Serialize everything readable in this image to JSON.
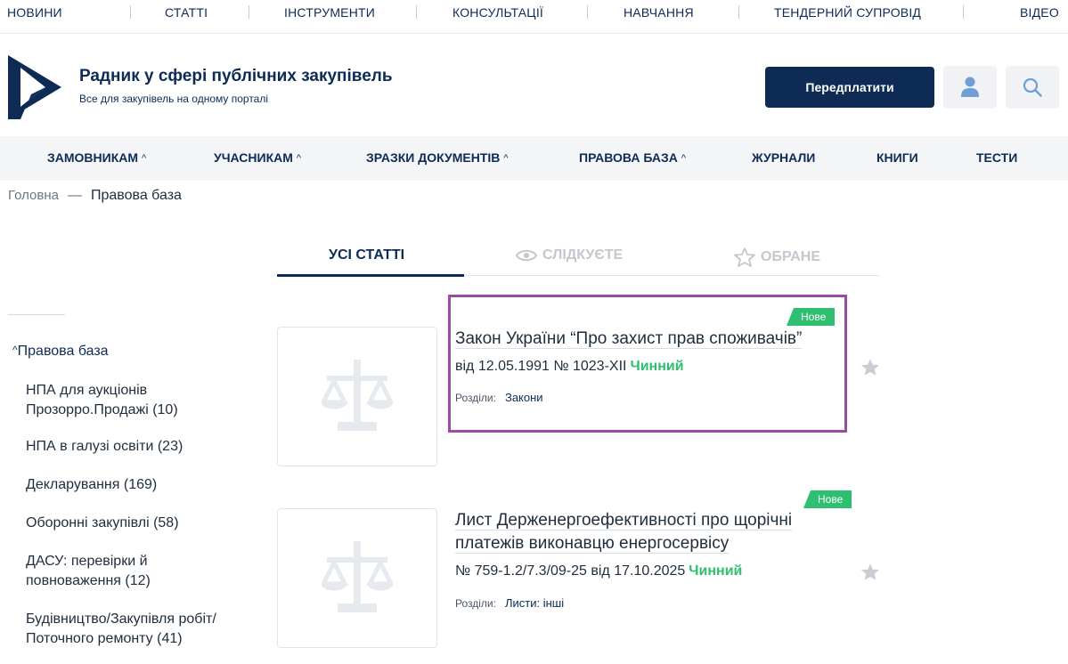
{
  "top_nav": [
    "НОВИНИ",
    "СТАТТІ",
    "ІНСТРУМЕНТИ",
    "КОНСУЛЬТАЦІЇ",
    "НАВЧАННЯ",
    "ТЕНДЕРНИЙ СУПРОВІД",
    "ВІДЕО"
  ],
  "header": {
    "title": "Радник у сфері публічних закупівель",
    "subtitle": "Все для закупівель на одному порталі",
    "subscribe_label": "Передплатити",
    "user_icon": "user-icon",
    "search_icon": "search-icon",
    "brand_color": "#0d2b55"
  },
  "main_nav": [
    "ЗАМОВНИКАМ",
    "УЧАСНИКАМ",
    "ЗРАЗКИ ДОКУМЕНТІВ",
    "ПРАВОВА БАЗА",
    "ЖУРНАЛИ",
    "КНИГИ",
    "ТЕСТИ"
  ],
  "breadcrumb": {
    "home": "Головна",
    "separator": "—",
    "current": "Правова база"
  },
  "tabs": [
    {
      "label": "УСІ СТАТТІ",
      "active": true
    },
    {
      "label": "СЛІДКУЄТЕ",
      "icon": "eye-icon",
      "active": false
    },
    {
      "label": "ОБРАНЕ",
      "icon": "star-outline-icon",
      "active": false
    }
  ],
  "sidebar": {
    "heading": "Правова база",
    "items": [
      {
        "line1": "НПА для аукціонів",
        "line2": "Прозорро.Продажі (10)"
      },
      {
        "line1": "НПА в галузі освіти (23)",
        "line2": ""
      },
      {
        "line1": "Декларування (169)",
        "line2": ""
      },
      {
        "line1": "Оборонні закупівлі (58)",
        "line2": ""
      },
      {
        "line1": "ДАСУ: перевірки й",
        "line2": "повноваження (12)"
      },
      {
        "line1": "Будівництво/Закупівля робіт/",
        "line2": "Поточного ремонту (41)"
      }
    ]
  },
  "articles": [
    {
      "badge": "Нове",
      "title_line1": "Закон України “Про захист прав споживачів”",
      "title_line2": "",
      "meta": "від 12.05.1991 № 1023-XII",
      "status": "Чинний",
      "sections_label": "Розділи:",
      "section": "Закони",
      "thumb_icon": "scales-icon",
      "status_color": "#2fbf71"
    },
    {
      "badge": "Нове",
      "title_line1": "Лист Держенергоефективності про щорічні",
      "title_line2": "платежів виконавцю енергосервісу",
      "meta": "№ 759-1.2/7.3/09-25 від 17.10.2025",
      "status": "Чинний",
      "sections_label": "Розділи:",
      "section": "Листи: інші",
      "thumb_icon": "scales-icon",
      "status_color": "#2fbf71"
    }
  ]
}
